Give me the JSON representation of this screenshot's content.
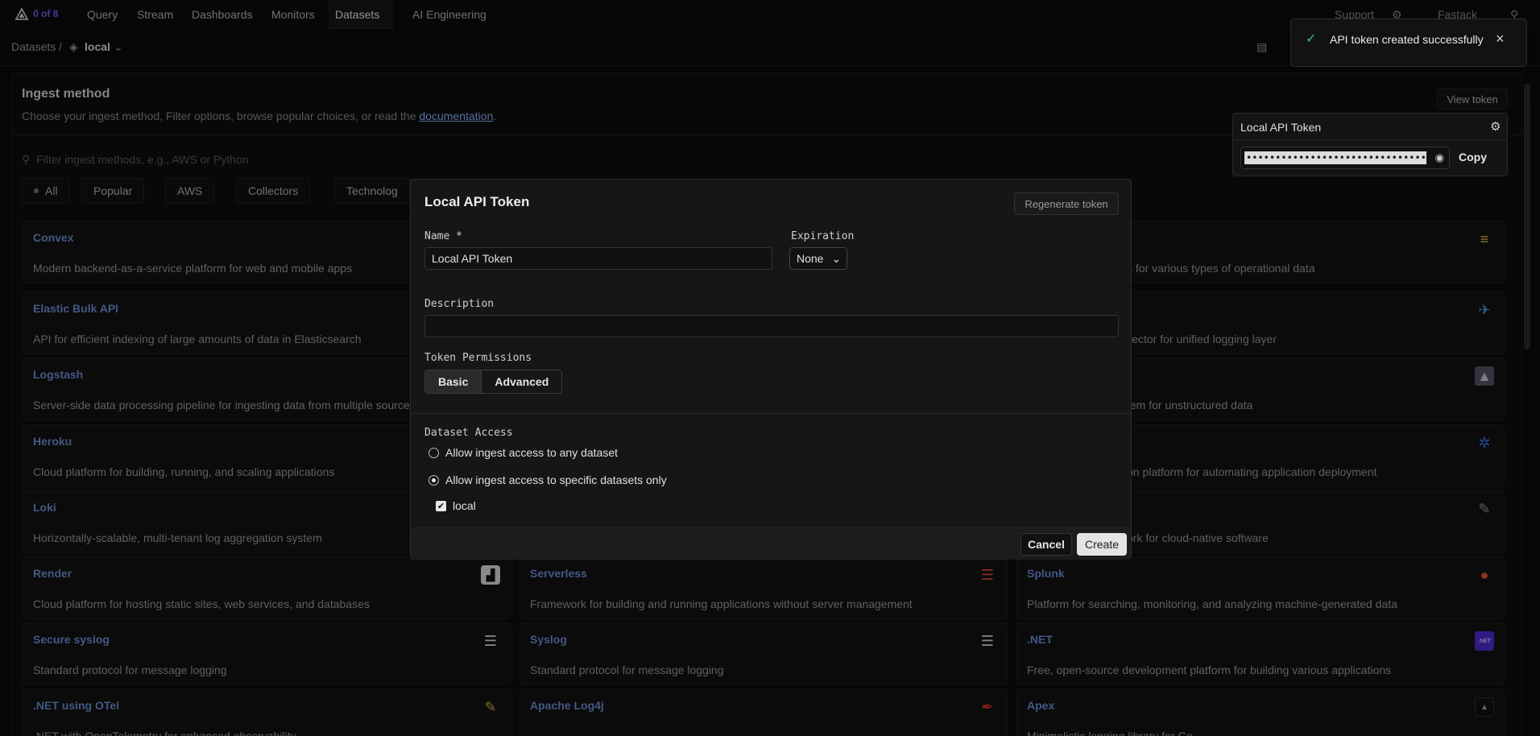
{
  "nav": {
    "count_label": "0 of 8",
    "items": [
      "Query",
      "Stream",
      "Dashboards",
      "Monitors",
      "Datasets",
      "AI Engineering"
    ],
    "support": "Support",
    "org": "Fastack"
  },
  "breadcrumb": {
    "root": "Datasets",
    "sep": "/",
    "current": "local"
  },
  "ingest": {
    "title": "Ingest method",
    "subtitle": "Choose your ingest method, Filter options, browse popular choices, or read the",
    "doc_link": "documentation",
    "subtitle_end": ".",
    "view_token": "View token",
    "search_placeholder": "Filter ingest methods, e.g., AWS or Python",
    "chips": [
      "All",
      "Popular",
      "AWS",
      "Collectors",
      "Technolog"
    ]
  },
  "cards_left": [
    {
      "title": "Convex",
      "desc": "Modern backend-as-a-service platform for web and mobile apps"
    },
    {
      "title": "Elastic Bulk API",
      "desc": "API for efficient indexing of large amounts of data in Elasticsearch"
    },
    {
      "title": "Logstash",
      "desc": "Server-side data processing pipeline for ingesting data from multiple sources"
    },
    {
      "title": "Heroku",
      "desc": "Cloud platform for building, running, and scaling applications"
    },
    {
      "title": "Loki",
      "desc": "Horizontally-scalable, multi-tenant log aggregation system"
    },
    {
      "title": "Render",
      "desc": "Cloud platform for hosting static sites, web services, and databases"
    },
    {
      "title": "Secure syslog",
      "desc": "Standard protocol for message logging"
    },
    {
      "title": ".NET using OTel",
      "desc": ".NET with OpenTelemetry for enhanced observability"
    }
  ],
  "cards_mid": [
    {
      "title": "Serverless",
      "desc": "Framework for building and running applications without server management"
    },
    {
      "title": "Syslog",
      "desc": "Standard protocol for message logging"
    },
    {
      "title": "Apache Log4j",
      "desc": ""
    }
  ],
  "cards_right": [
    {
      "title": "",
      "desc": "ppers for various types of operational data"
    },
    {
      "title": "",
      "desc": "llector for unified logging layer"
    },
    {
      "title": "",
      "desc": "tem for unstructured data"
    },
    {
      "title": "",
      "desc": "on platform for automating application deployment"
    },
    {
      "title": "",
      "desc": "ork for cloud-native software"
    },
    {
      "title": "Splunk",
      "desc": "Platform for searching, monitoring, and analyzing machine-generated data"
    },
    {
      "title": ".NET",
      "desc": "Free, open-source development platform for building various applications"
    },
    {
      "title": "Apex",
      "desc": "Minimalistic logging library for Go"
    }
  ],
  "modal": {
    "title": "Local API Token",
    "regenerate": "Regenerate token",
    "name_label": "Name *",
    "name_value": "Local API Token",
    "expiration_label": "Expiration",
    "expiration_value": "None",
    "description_label": "Description",
    "description_value": "",
    "permissions_label": "Token Permissions",
    "perm_basic": "Basic",
    "perm_advanced": "Advanced",
    "dataset_access_label": "Dataset Access",
    "option_any": "Allow ingest access to any dataset",
    "option_specific": "Allow ingest access to specific datasets only",
    "dataset_checked": "local",
    "cancel": "Cancel",
    "create": "Create"
  },
  "token_popover": {
    "title": "Local API Token",
    "token_masked": "••••••••••••••••••••••••••••••••••",
    "copy": "Copy"
  },
  "toast": {
    "message": "API token created successfully"
  },
  "colors": {
    "accent": "#7a5cff",
    "link": "#6c8fd6",
    "success": "#3fbf6a"
  }
}
